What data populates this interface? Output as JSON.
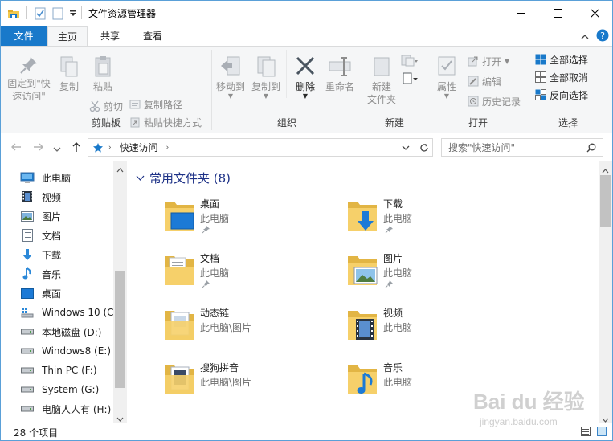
{
  "window": {
    "title": "文件资源管理器",
    "minimize_glyph": "—",
    "maximize_glyph": "☐",
    "close_glyph": "✕"
  },
  "tabs": {
    "file": "文件",
    "home": "主页",
    "share": "共享",
    "view": "查看"
  },
  "ribbon": {
    "clipboard": {
      "label": "剪贴板",
      "pin": "固定到\"快\n速访问\"",
      "pin_l1": "固定到\"快",
      "pin_l2": "速访问\"",
      "copy": "复制",
      "paste": "粘贴",
      "cut": "剪切",
      "copy_path": "复制路径",
      "paste_shortcut": "粘贴快捷方式"
    },
    "organize": {
      "label": "组织",
      "move_to": "移动到",
      "copy_to": "复制到",
      "delete": "删除",
      "rename": "重命名"
    },
    "new": {
      "label": "新建",
      "new_folder_l1": "新建",
      "new_folder_l2": "文件夹"
    },
    "open": {
      "label": "打开",
      "properties": "属性",
      "open": "打开",
      "edit": "编辑",
      "history": "历史记录"
    },
    "select": {
      "label": "选择",
      "select_all": "全部选择",
      "select_none": "全部取消",
      "invert": "反向选择"
    }
  },
  "address": {
    "location": "快速访问",
    "search_placeholder": "搜索\"快速访问\""
  },
  "nav_pane": {
    "items": [
      {
        "label": "此电脑",
        "icon": "computer-icon"
      },
      {
        "label": "视频",
        "icon": "videos-icon"
      },
      {
        "label": "图片",
        "icon": "pictures-icon"
      },
      {
        "label": "文档",
        "icon": "documents-icon"
      },
      {
        "label": "下载",
        "icon": "downloads-icon"
      },
      {
        "label": "音乐",
        "icon": "music-icon"
      },
      {
        "label": "桌面",
        "icon": "desktop-icon"
      },
      {
        "label": "Windows 10 (C",
        "icon": "windows-drive-icon"
      },
      {
        "label": "本地磁盘 (D:)",
        "icon": "drive-icon"
      },
      {
        "label": "Windows8 (E:)",
        "icon": "drive-icon"
      },
      {
        "label": "Thin PC (F:)",
        "icon": "drive-icon"
      },
      {
        "label": "System (G:)",
        "icon": "drive-icon"
      },
      {
        "label": "电脑人人有 (H:)",
        "icon": "drive-icon"
      }
    ]
  },
  "content": {
    "section_title": "常用文件夹 (8)",
    "folders": [
      {
        "name": "桌面",
        "location": "此电脑",
        "pinned": true,
        "icon": "desktop-folder-icon"
      },
      {
        "name": "下载",
        "location": "此电脑",
        "pinned": true,
        "icon": "downloads-folder-icon"
      },
      {
        "name": "文档",
        "location": "此电脑",
        "pinned": true,
        "icon": "documents-folder-icon"
      },
      {
        "name": "图片",
        "location": "此电脑",
        "pinned": true,
        "icon": "pictures-folder-icon"
      },
      {
        "name": "动态链",
        "location": "此电脑\\图片",
        "pinned": false,
        "icon": "folder-icon"
      },
      {
        "name": "视频",
        "location": "此电脑",
        "pinned": false,
        "icon": "videos-folder-icon"
      },
      {
        "name": "搜狗拼音",
        "location": "此电脑\\图片",
        "pinned": false,
        "icon": "folder-icon"
      },
      {
        "name": "音乐",
        "location": "此电脑",
        "pinned": false,
        "icon": "music-folder-icon"
      }
    ]
  },
  "status": {
    "item_count": "28 个项目"
  },
  "watermark": {
    "brand": "Bai du 经验",
    "url": "jingyan.baidu.com"
  },
  "colors": {
    "accent": "#1979ca",
    "section_title": "#1e3287",
    "folder": "#f3c94e"
  }
}
